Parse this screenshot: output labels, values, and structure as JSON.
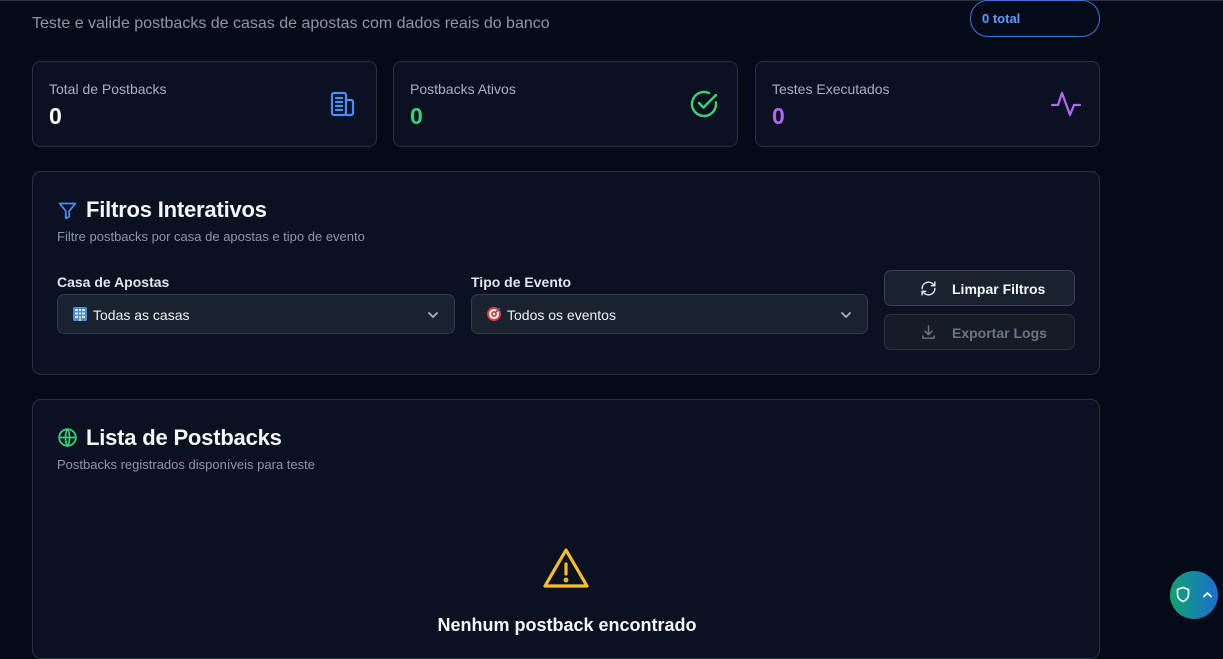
{
  "header": {
    "subtitle": "Teste e valide postbacks de casas de apostas com dados reais do banco",
    "total_badge": "0 total"
  },
  "stats": [
    {
      "label": "Total de Postbacks",
      "value": "0",
      "icon": "building-icon",
      "color": "#ffffff",
      "icon_color": "#4a8df5"
    },
    {
      "label": "Postbacks Ativos",
      "value": "0",
      "icon": "check-circle-icon",
      "color": "#36d37a",
      "icon_color": "#36d37a"
    },
    {
      "label": "Testes Executados",
      "value": "0",
      "icon": "activity-icon",
      "color": "#b068f0",
      "icon_color": "#b068f0"
    }
  ],
  "filters": {
    "title": "Filtros Interativos",
    "description": "Filtre postbacks por casa de apostas e tipo de evento",
    "casa_label": "Casa de Apostas",
    "casa_value": "Todas as casas",
    "evento_label": "Tipo de Evento",
    "evento_value": "Todos os eventos",
    "clear_button": "Limpar Filtros",
    "export_button": "Exportar Logs"
  },
  "list": {
    "title": "Lista de Postbacks",
    "description": "Postbacks registrados disponíveis para teste",
    "empty_title": "Nenhum postback encontrado"
  },
  "colors": {
    "accent_blue": "#4a8df5",
    "accent_green": "#36d37a",
    "accent_purple": "#b068f0",
    "warning": "#f5c02a"
  }
}
